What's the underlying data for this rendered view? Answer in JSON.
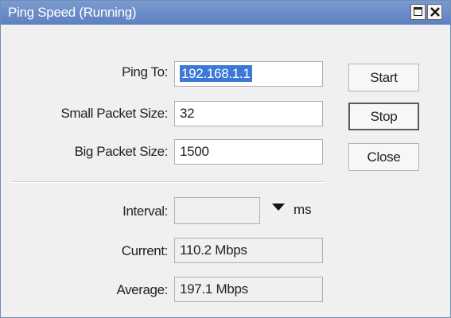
{
  "window": {
    "title": "Ping Speed (Running)"
  },
  "form": {
    "ping_to": {
      "label": "Ping To:",
      "value": "192.168.1.1"
    },
    "small_packet_size": {
      "label": "Small Packet Size:",
      "value": "32"
    },
    "big_packet_size": {
      "label": "Big Packet Size:",
      "value": "1500"
    },
    "interval": {
      "label": "Interval:",
      "value": "",
      "unit": "ms"
    },
    "current": {
      "label": "Current:",
      "value": "110.2 Mbps"
    },
    "average": {
      "label": "Average:",
      "value": "197.1 Mbps"
    }
  },
  "buttons": {
    "start": "Start",
    "stop": "Stop",
    "close": "Close"
  },
  "icons": {
    "maximize": "maximize-icon",
    "close": "close-icon",
    "dropdown": "triangle-down-icon"
  },
  "colors": {
    "titlebar": "#6a8cc8",
    "selection": "#3c78d8"
  }
}
